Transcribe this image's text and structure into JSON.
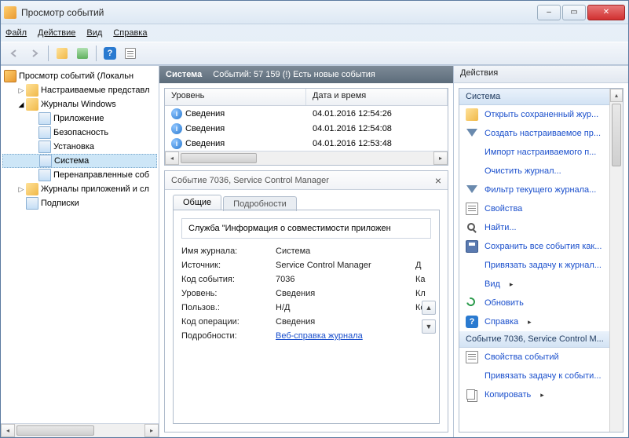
{
  "window": {
    "title": "Просмотр событий"
  },
  "menu": {
    "file": "Файл",
    "action": "Действие",
    "view": "Вид",
    "help": "Справка"
  },
  "tree": {
    "root": "Просмотр событий (Локальн",
    "custom_views": "Настраиваемые представл",
    "win_logs": "Журналы Windows",
    "app": "Приложение",
    "security": "Безопасность",
    "setup": "Установка",
    "system": "Система",
    "forwarded": "Перенаправленные соб",
    "apps_services": "Журналы приложений и сл",
    "subscriptions": "Подписки"
  },
  "mid": {
    "title": "Система",
    "count": "Событий: 57 159 (!) Есть новые события",
    "col_level": "Уровень",
    "col_date": "Дата и время",
    "rows": [
      {
        "level": "Сведения",
        "date": "04.01.2016 12:54:26"
      },
      {
        "level": "Сведения",
        "date": "04.01.2016 12:54:08"
      },
      {
        "level": "Сведения",
        "date": "04.01.2016 12:53:48"
      }
    ]
  },
  "detail": {
    "header": "Событие 7036, Service Control Manager",
    "tab_general": "Общие",
    "tab_details": "Подробности",
    "description": "Служба \"Информация о совместимости приложен",
    "props": {
      "log_name_k": "Имя журнала:",
      "log_name_v": "Система",
      "source_k": "Источник:",
      "source_v": "Service Control Manager",
      "source_extra": "Д",
      "event_id_k": "Код события:",
      "event_id_v": "7036",
      "event_id_extra": "Ка",
      "level_k": "Уровень:",
      "level_v": "Сведения",
      "level_extra": "Кл",
      "user_k": "Пользов.:",
      "user_v": "Н/Д",
      "user_extra": "Кс",
      "opcode_k": "Код операции:",
      "opcode_v": "Сведения",
      "more_k": "Подробности:",
      "more_v": "Веб-справка журнала"
    }
  },
  "actions": {
    "header": "Действия",
    "group1": "Система",
    "items1": [
      "Открыть сохраненный жур...",
      "Создать настраиваемое пр...",
      "Импорт настраиваемого п...",
      "Очистить журнал...",
      "Фильтр текущего журнала...",
      "Свойства",
      "Найти...",
      "Сохранить все события как...",
      "Привязать задачу к журнал...",
      "Вид",
      "Обновить",
      "Справка"
    ],
    "group2": "Событие 7036, Service Control M...",
    "items2": [
      "Свойства событий",
      "Привязать задачу к событи...",
      "Копировать"
    ]
  }
}
